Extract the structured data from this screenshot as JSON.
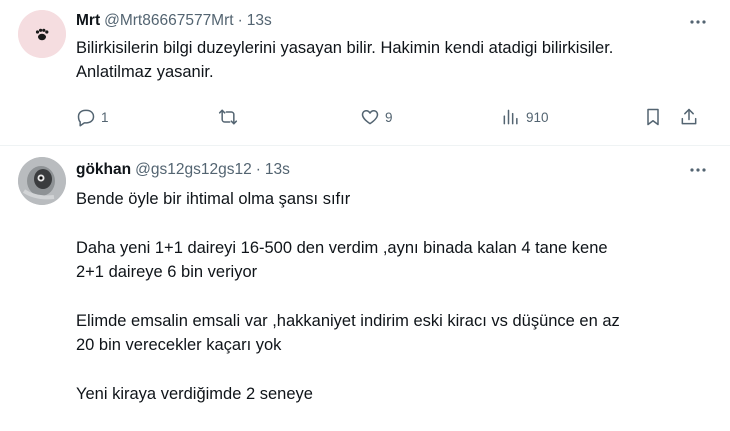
{
  "tweets": [
    {
      "name": "Mrt",
      "handle": "@Mrt86667577Mrt",
      "separator": "·",
      "time": "13s",
      "lines": [
        "Bilirkisilerin bilgi duzeylerini yasayan bilir. Hakimin kendi atadigi bilirkisiler.",
        "Anlatilmaz yasanir."
      ],
      "actions": {
        "reply_count": "1",
        "retweet_count": "",
        "like_count": "9",
        "view_count": "910"
      },
      "icons": [
        "reply-icon",
        "retweet-icon",
        "like-icon",
        "views-icon",
        "bookmark-icon",
        "share-icon"
      ]
    },
    {
      "name": "gökhan",
      "handle": "@gs12gs12gs12",
      "separator": "·",
      "time": "13s",
      "paragraphs": [
        [
          "Bende öyle bir ihtimal olma şansı sıfır"
        ],
        [
          "Daha yeni 1+1 daireyi 16-500 den verdim ,aynı binada kalan 4 tane kene",
          "2+1 daireye 6 bin veriyor"
        ],
        [
          "Elimde emsalin emsali var ,hakkaniyet indirim eski kiracı vs düşünce en az",
          "20 bin verecekler kaçarı yok"
        ],
        [
          "Yeni kiraya verdiğimde 2 seneye"
        ]
      ]
    }
  ],
  "colors": {
    "text": "#0f1419",
    "secondary": "#536471",
    "divider": "#eff3f4",
    "avatar1_bg": "#f5dde0"
  }
}
